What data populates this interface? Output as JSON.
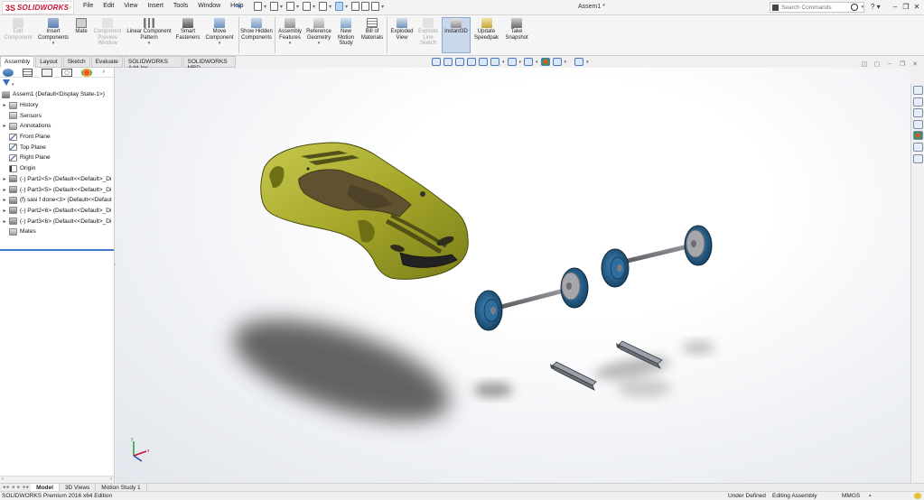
{
  "app": {
    "brand": "SOLIDWORKS",
    "brand_mark": "3S",
    "document_title": "Assem1 *"
  },
  "menu": [
    "File",
    "Edit",
    "View",
    "Insert",
    "Tools",
    "Window",
    "Help"
  ],
  "search": {
    "placeholder": "Search Commands"
  },
  "commands": {
    "edit_component": "Edit Component",
    "insert_components": "Insert Components",
    "mate": "Mate",
    "component_preview": "Component Preview Window",
    "linear_pattern": "Linear Component Pattern",
    "smart_fasteners": "Smart Fasteners",
    "move_component": "Move Component",
    "show_hidden": "Show Hidden Components",
    "assembly_features": "Assembly Features",
    "reference_geometry": "Reference Geometry",
    "new_motion_study": "New Motion Study",
    "bill_of_materials": "Bill of Materials",
    "exploded_view": "Exploded View",
    "explode_line_sketch": "Explode Line Sketch",
    "instant3d": "Instant3D",
    "update_speedpak": "Update Speedpak",
    "take_snapshot": "Take Snapshot"
  },
  "command_tabs": [
    "Assembly",
    "Layout",
    "Sketch",
    "Evaluate",
    "SOLIDWORKS Add-Ins",
    "SOLIDWORKS MBD"
  ],
  "tree": {
    "root": "Assem1  (Default<Display State-1>)",
    "items": [
      {
        "label": "History",
        "expandable": true
      },
      {
        "label": "Sensors",
        "expandable": false
      },
      {
        "label": "Annotations",
        "expandable": true
      },
      {
        "label": "Front Plane",
        "expandable": false
      },
      {
        "label": "Top Plane",
        "expandable": false
      },
      {
        "label": "Right Plane",
        "expandable": false
      },
      {
        "label": "Origin",
        "expandable": false
      },
      {
        "label": "(-) Part2<5> (Default<<Default>_Di",
        "expandable": true
      },
      {
        "label": "(-) Part3<5> (Default<<Default>_Di",
        "expandable": true
      },
      {
        "label": "(f) sasi f done<3> (Default<<Defaul",
        "expandable": true
      },
      {
        "label": "(-) Part2<6> (Default<<Default>_Di",
        "expandable": true
      },
      {
        "label": "(-) Part3<6> (Default<<Default>_Di",
        "expandable": true
      },
      {
        "label": "Mates",
        "expandable": false
      }
    ]
  },
  "bottom_tabs": [
    "Model",
    "3D Views",
    "Motion Study 1"
  ],
  "status": {
    "edition": "SOLIDWORKS Premium 2016 x64 Edition",
    "definition": "Under Defined",
    "mode": "Editing Assembly",
    "units": "MMGS"
  },
  "colors": {
    "brand_red": "#c8102e",
    "car_body": "#a5a72a",
    "wheel": "#2f6fa0",
    "axle": "#7b7b80",
    "selection_blue": "#3f7cc8"
  },
  "model_parts": [
    "car-body",
    "front-axle-assembly",
    "rear-axle-assembly",
    "rail-part-1",
    "rail-part-2"
  ]
}
